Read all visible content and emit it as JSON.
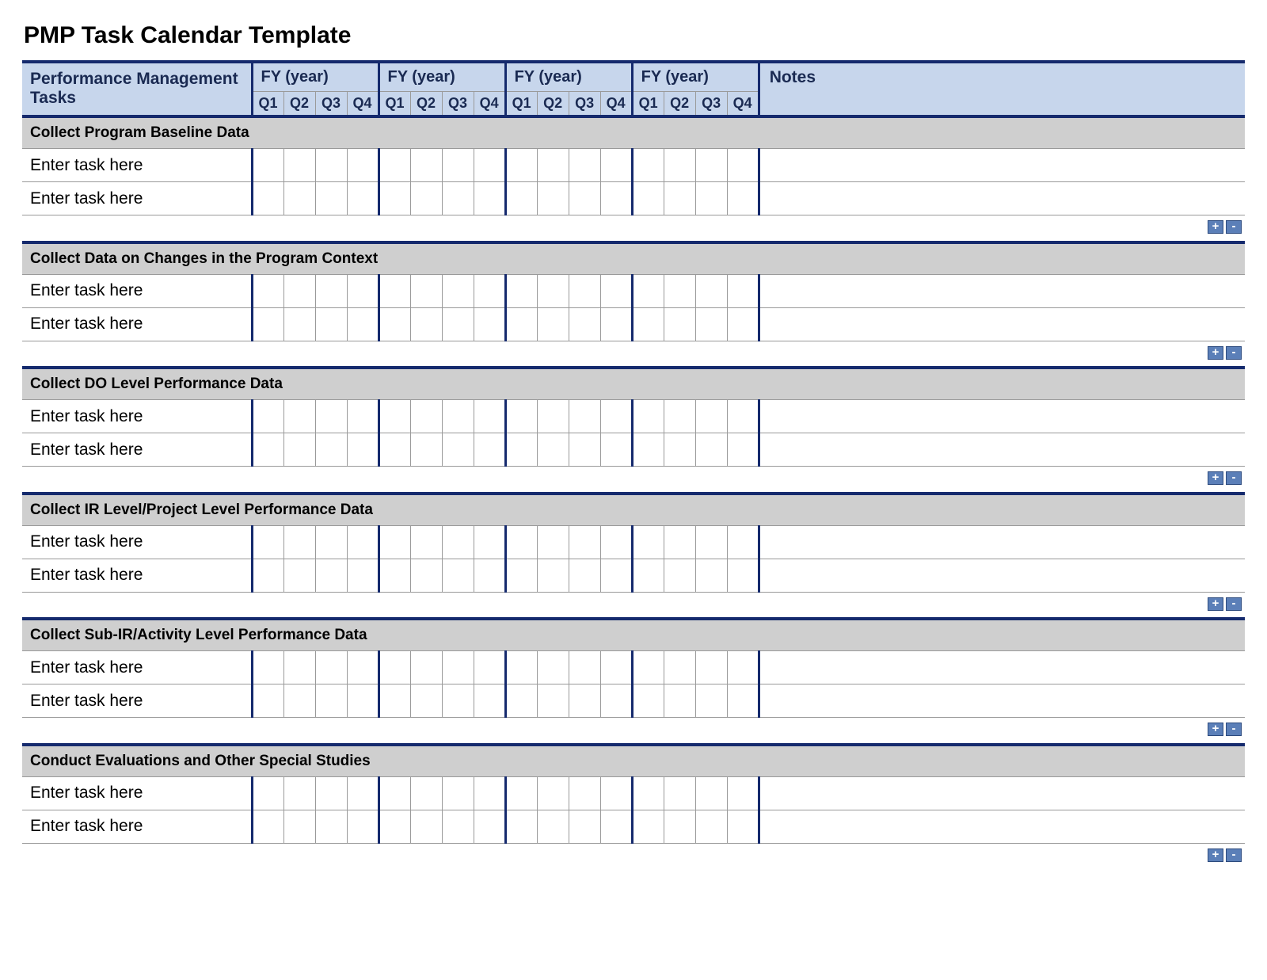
{
  "title": "PMP Task Calendar Template",
  "header": {
    "tasks_label": "Performance Management Tasks",
    "fy_label": "FY  (year)",
    "quarters": [
      "Q1",
      "Q2",
      "Q3",
      "Q4"
    ],
    "notes_label": "Notes"
  },
  "task_placeholder": "Enter task here",
  "sections": [
    {
      "label": "Collect Program Baseline Data"
    },
    {
      "label": "Collect Data on Changes in the Program Context"
    },
    {
      "label": "Collect DO Level Performance Data"
    },
    {
      "label": "Collect IR Level/Project Level Performance Data"
    },
    {
      "label": "Collect Sub-IR/Activity Level Performance Data"
    },
    {
      "label": "Conduct Evaluations and Other Special Studies"
    }
  ],
  "controls": {
    "add": "+",
    "remove": "-"
  }
}
